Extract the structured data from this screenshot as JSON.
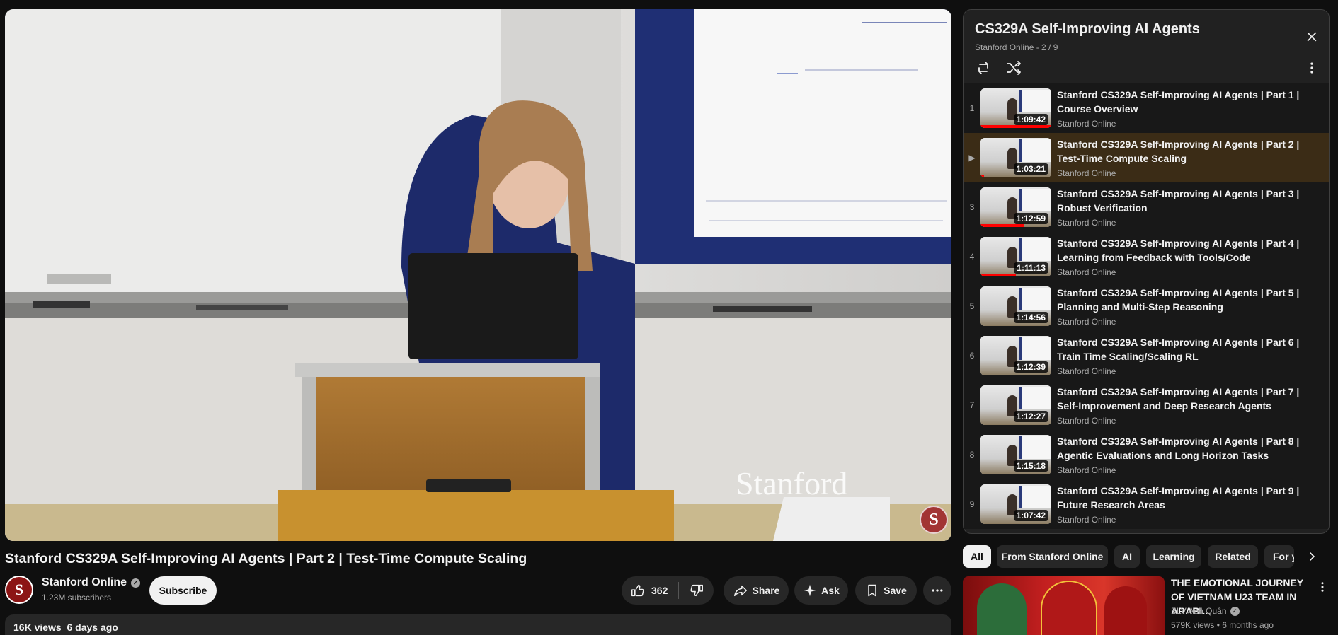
{
  "video": {
    "watermark": "Stanford",
    "title": "Stanford CS329A Self-Improving AI Agents | Part 2 | Test-Time Compute Scaling",
    "channel": "Stanford Online",
    "subscribers": "1.23M subscribers",
    "subscribe_label": "Subscribe",
    "likes": "362",
    "share_label": "Share",
    "ask_label": "Ask",
    "save_label": "Save",
    "views": "16K views",
    "date": "6 days ago"
  },
  "playlist": {
    "title": "CS329A Self-Improving AI Agents",
    "subtitle": "Stanford Online - 2 / 9",
    "items": [
      {
        "index": "1",
        "title": "Stanford CS329A Self-Improving AI Agents | Part 1 | Course Overview",
        "channel": "Stanford Online",
        "duration": "1:09:42",
        "progress": 1.0
      },
      {
        "index": "▶",
        "title": "Stanford CS329A Self-Improving AI Agents | Part 2 | Test-Time Compute Scaling",
        "channel": "Stanford Online",
        "duration": "1:03:21",
        "progress": 0.05
      },
      {
        "index": "3",
        "title": "Stanford CS329A Self-Improving AI Agents | Part 3 | Robust Verification",
        "channel": "Stanford Online",
        "duration": "1:12:59",
        "progress": 0.62
      },
      {
        "index": "4",
        "title": "Stanford CS329A Self-Improving AI Agents | Part 4 | Learning from Feedback with Tools/Code",
        "channel": "Stanford Online",
        "duration": "1:11:13",
        "progress": 0.5
      },
      {
        "index": "5",
        "title": "Stanford CS329A Self-Improving AI Agents | Part 5 | Planning and Multi-Step Reasoning",
        "channel": "Stanford Online",
        "duration": "1:14:56",
        "progress": 0
      },
      {
        "index": "6",
        "title": "Stanford CS329A Self-Improving AI Agents | Part 6 | Train Time Scaling/Scaling RL",
        "channel": "Stanford Online",
        "duration": "1:12:39",
        "progress": 0
      },
      {
        "index": "7",
        "title": "Stanford CS329A Self-Improving AI Agents | Part 7 | Self-Improvement and Deep Research Agents",
        "channel": "Stanford Online",
        "duration": "1:12:27",
        "progress": 0
      },
      {
        "index": "8",
        "title": "Stanford CS329A Self-Improving AI Agents | Part 8 | Agentic Evaluations and Long Horizon Tasks",
        "channel": "Stanford Online",
        "duration": "1:15:18",
        "progress": 0
      },
      {
        "index": "9",
        "title": "Stanford CS329A Self-Improving AI Agents | Part 9 | Future Research Areas",
        "channel": "Stanford Online",
        "duration": "1:07:42",
        "progress": 0
      }
    ]
  },
  "chips": [
    "All",
    "From Stanford Online",
    "AI",
    "Learning",
    "Related",
    "For y"
  ],
  "recommended": {
    "title": "THE EMOTIONAL JOURNEY OF VIETNAM U23 TEAM IN ARABI...",
    "channel": "BLV Anh Quân",
    "views": "579K views",
    "age": "6 months ago"
  },
  "colors": {
    "accent_red": "#ff0000",
    "active_row": "#3b2c16",
    "chip_active": "#f1f1f1"
  },
  "icons": [
    "close-icon",
    "loop-icon",
    "shuffle-icon",
    "more-vert-icon",
    "thumbs-up-icon",
    "thumbs-down-icon",
    "share-icon",
    "sparkle-icon",
    "save-icon",
    "chevron-right-icon",
    "verified-icon"
  ]
}
